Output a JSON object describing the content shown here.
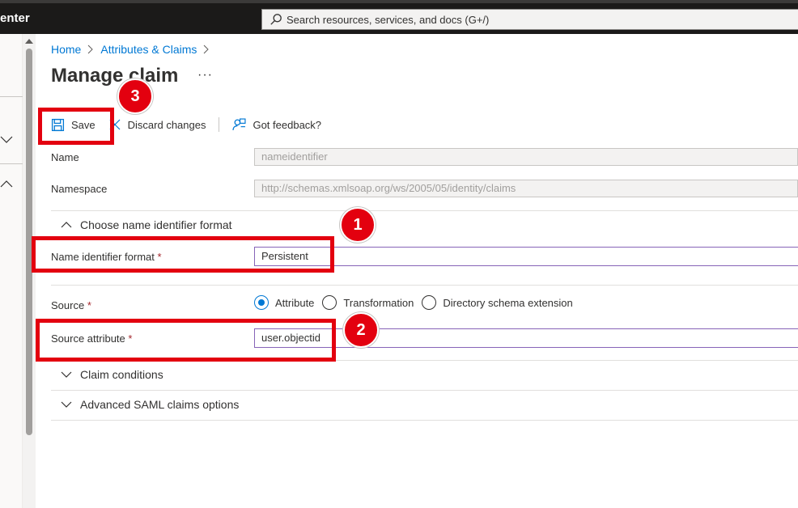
{
  "app": {
    "title_fragment": "enter"
  },
  "search": {
    "placeholder": "Search resources, services, and docs (G+/)"
  },
  "breadcrumb": {
    "items": [
      "Home",
      "Attributes & Claims"
    ]
  },
  "page": {
    "title": "Manage claim",
    "more": "···"
  },
  "toolbar": {
    "save_label": "Save",
    "discard_label": "Discard changes",
    "feedback_label": "Got feedback?"
  },
  "form": {
    "name": {
      "label": "Name",
      "value": "nameidentifier"
    },
    "namespace": {
      "label": "Namespace",
      "value": "http://schemas.xmlsoap.org/ws/2005/05/identity/claims"
    },
    "name_format_section": "Choose name identifier format",
    "name_identifier_format": {
      "label": "Name identifier format",
      "required": "*",
      "value": "Persistent"
    },
    "source": {
      "label": "Source",
      "required": "*",
      "options": [
        "Attribute",
        "Transformation",
        "Directory schema extension"
      ],
      "selected": "Attribute"
    },
    "source_attribute": {
      "label": "Source attribute",
      "required": "*",
      "value": "user.objectid"
    },
    "claim_conditions": "Claim conditions",
    "advanced_saml": "Advanced SAML claims options"
  },
  "annotations": {
    "badge1": "1",
    "badge2": "2",
    "badge3": "3"
  },
  "colors": {
    "accent": "#0078d4",
    "highlight": "#e3000f",
    "required": "#a4262c"
  }
}
